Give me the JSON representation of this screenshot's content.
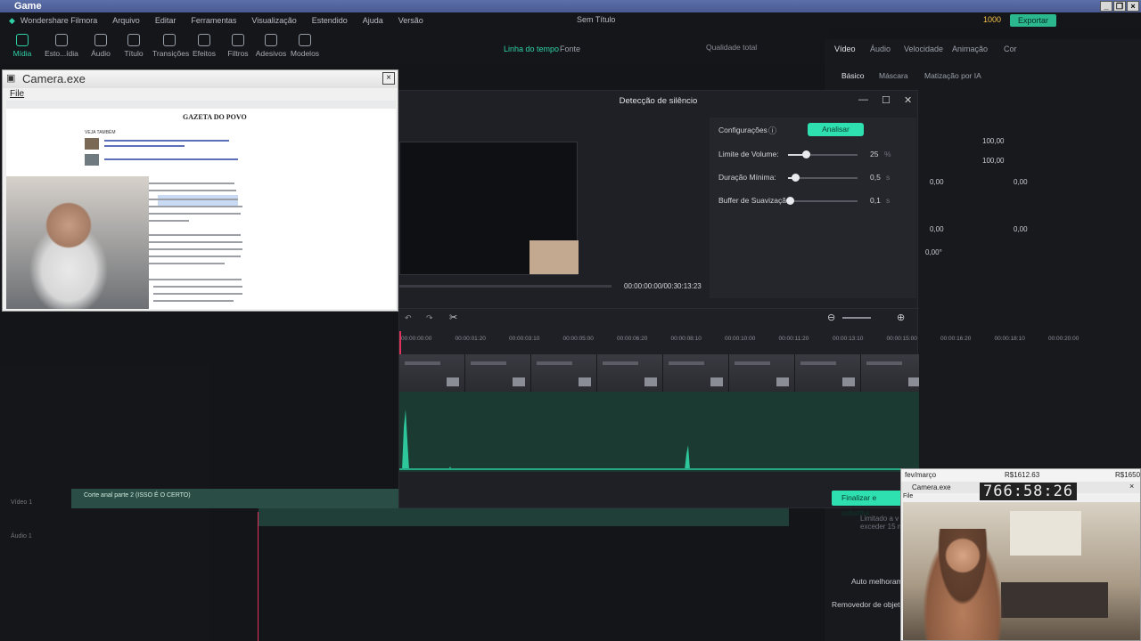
{
  "window": {
    "title": "Game",
    "buttons": [
      "_",
      "❐",
      "×"
    ]
  },
  "menu": [
    "Wondershare Filmora",
    "Arquivo",
    "Editar",
    "Ferramentas",
    "Visualização",
    "Estendido",
    "Ajuda",
    "Versão"
  ],
  "project_title": "Sem Título",
  "credits": "1000",
  "export_label": "Exportar",
  "toolbar": [
    "Mídia",
    "Esto...ídia",
    "Áudio",
    "Título",
    "Transições",
    "Efeitos",
    "Filtros",
    "Adesivos",
    "Modelos"
  ],
  "player_tabs": [
    "Linha do tempo",
    "Fonte"
  ],
  "quality": "Qualidade total",
  "right_tabs": [
    "Vídeo",
    "Áudio",
    "Velocidade",
    "Animação",
    "Cor"
  ],
  "right_subtabs": [
    "Básico",
    "Máscara",
    "Matização por IA"
  ],
  "right_values": [
    "100,00",
    "100,00",
    "0,00",
    "0,00",
    "0,00",
    "0,00",
    "0,00°"
  ],
  "right_bottom": {
    "auto": "Auto melhoram",
    "remover": "Removedor de objeto",
    "limit": "Limitado a v exceder 15 m"
  },
  "dialog": {
    "title": "Detecção de silêncio",
    "config_label": "Configurações",
    "analyze": "Analisar",
    "params": [
      {
        "label": "Limite de Volume:",
        "value": "25",
        "unit": "%",
        "pct": 0.25
      },
      {
        "label": "Duração Mínima:",
        "value": "0,5",
        "unit": "s",
        "pct": 0.1
      },
      {
        "label": "Buffer de Suavização:",
        "value": "0,1",
        "unit": "s",
        "pct": 0.02
      }
    ],
    "time": "00:00:00:00/00:30:13:23",
    "ruler": [
      "00:00:00:00",
      "00:00:01:20",
      "00:00:03:10",
      "00:00:05:00",
      "00:00:06:20",
      "00:00:08:10",
      "00:00:10:00",
      "00:00:11:20",
      "00:00:13:10",
      "00:00:15:00",
      "00:00:16:20",
      "00:00:18:10",
      "00:00:20:00"
    ],
    "finalize": "Finalizar e substitui"
  },
  "cam1": {
    "title": "Camera.exe",
    "menu": "File",
    "paper": "GAZETA DO POVO",
    "section": "VEJA TAMBÉM"
  },
  "cam2": {
    "header_left": "fev/março",
    "header_mid": "R$1612.63",
    "header_right": "R$1650",
    "title": "Camera.exe",
    "menu": "File",
    "clock": "766:58:26"
  },
  "track": {
    "clip": "Corte anal parte 2 (ISSO É O CERTO)",
    "video_label": "Vídeo 1",
    "audio_label": "Áudio 1"
  },
  "colors": {
    "accent": "#2ee0b0",
    "playhead": "#e0325c",
    "waveform": "#2ec79c"
  }
}
